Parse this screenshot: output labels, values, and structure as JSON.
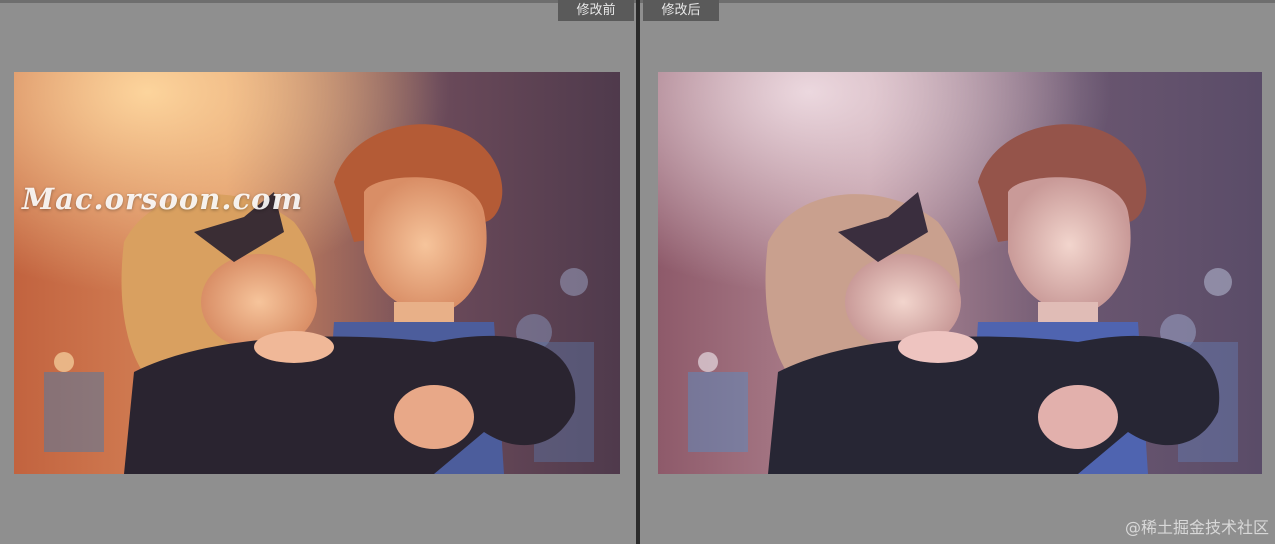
{
  "compare": {
    "before_label": "修改前",
    "after_label": "修改后"
  },
  "before_photo": {
    "watermark": "Mac.orsoon.com",
    "description_icon": "couple-photo-warm-icon"
  },
  "after_photo": {
    "description_icon": "couple-photo-cool-icon"
  },
  "footer": {
    "credit": "@稀土掘金技术社区"
  },
  "colors": {
    "workspace_bg": "#8f8f8f",
    "divider": "#2b2b2b",
    "label_bg": "#5a5a5a",
    "before_tone": "#e79a5a",
    "after_tone": "#b78ba8"
  }
}
